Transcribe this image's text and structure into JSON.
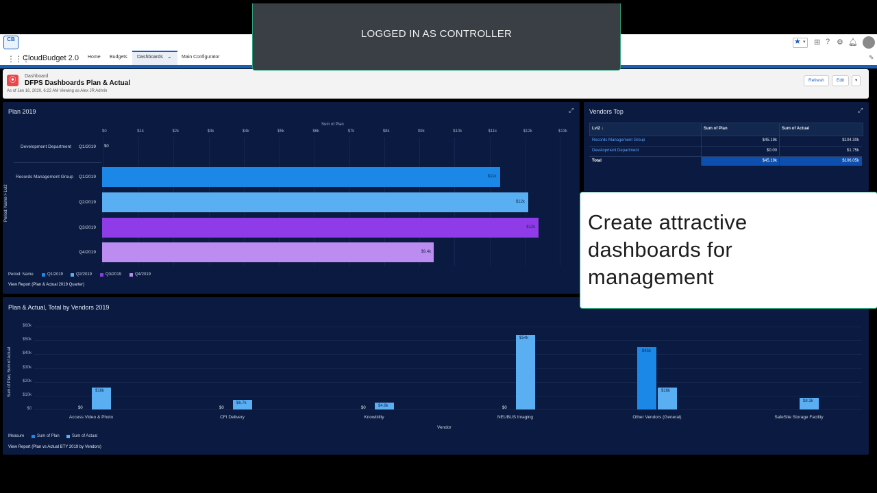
{
  "popup": {
    "text": "LOGGED IN AS CONTROLLER"
  },
  "callout": {
    "text": "Create attractive dashboards for management"
  },
  "header": {
    "logo": "CB",
    "app_name": "CloudBudget 2.0",
    "tabs": [
      "Home",
      "Budgets",
      "Dashboards",
      "Main Configurator"
    ],
    "icons": [
      "star-icon",
      "add-icon",
      "help-icon",
      "gear-icon",
      "bell-icon",
      "avatar"
    ]
  },
  "dashboard": {
    "type_label": "Dashboard",
    "title": "DFPS Dashboards Plan & Actual",
    "subtitle": "As of Jan 16, 2020, 6:22 AM Viewing as Alex JR Admin",
    "buttons": [
      "Refresh",
      "Edit"
    ]
  },
  "plan_panel": {
    "title": "Plan 2019",
    "axis_title": "Sum of Plan",
    "ticks": [
      "$0",
      "$1k",
      "$2k",
      "$3k",
      "$4k",
      "$5k",
      "$6k",
      "$7k",
      "$8k",
      "$9k",
      "$10k",
      "$11k",
      "$12k",
      "$13k"
    ],
    "y_axis_title": "Period: Name > Lvl2",
    "groups": [
      "Development Department",
      "Records Management Group"
    ],
    "legend_title": "Period: Name",
    "view_report": "View Report (Plan & Actual 2019 Quarter)"
  },
  "vendors_panel": {
    "title": "Vendors Top",
    "columns": [
      "Lvl2",
      "Sum of Plan",
      "Sum of Actual"
    ],
    "rows": [
      {
        "name": "Records Management Group",
        "plan": "$45.19k",
        "actual": "$104.30k"
      },
      {
        "name": "Development Department",
        "plan": "$0.00",
        "actual": "$1.75k"
      }
    ],
    "total": {
      "name": "Total",
      "plan": "$45.19k",
      "actual": "$106.05k"
    }
  },
  "vendors_chart_panel": {
    "title": "Plan & Actual, Total by Vendors 2019",
    "y_axis_title": "Sum of Plan, Sum of Actual",
    "x_axis_title": "Vendor",
    "ticks": [
      "$0",
      "$10k",
      "$20k",
      "$30k",
      "$40k",
      "$50k",
      "$60k"
    ],
    "legend_title": "Measure",
    "view_report": "View Report (Plan vs Actual BTY 2019 by Vendors)"
  },
  "colors": {
    "q1": "#1b87e6",
    "q2": "#5aaef2",
    "q3": "#8f3ce8",
    "q4": "#bd8cf0",
    "plan": "#1b87e6",
    "actual": "#5aaef2",
    "panel": "#0a1a40",
    "accent": "#1b5fb4"
  },
  "chart_data": [
    {
      "type": "bar",
      "orientation": "horizontal",
      "title": "Plan 2019",
      "xlabel": "Sum of Plan",
      "ylabel": "Period: Name > Lvl2",
      "xlim": [
        0,
        13000
      ],
      "categories": [
        "Q1/2019",
        "Q1/2019",
        "Q2/2019",
        "Q3/2019",
        "Q4/2019"
      ],
      "groups": [
        "Development Department",
        "Records Management Group",
        "Records Management Group",
        "Records Management Group",
        "Records Management Group"
      ],
      "values": [
        0,
        11300,
        12100,
        12400,
        9400
      ],
      "value_labels": [
        "$0",
        "$11k",
        "$12k",
        "$12k",
        "$9.4k"
      ],
      "colors": [
        "#1b87e6",
        "#1b87e6",
        "#5aaef2",
        "#8f3ce8",
        "#bd8cf0"
      ],
      "legend": [
        "Q1/2019",
        "Q2/2019",
        "Q3/2019",
        "Q4/2019"
      ],
      "legend_position": "bottom-left"
    },
    {
      "type": "bar",
      "title": "Plan & Actual, Total by Vendors 2019",
      "xlabel": "Vendor",
      "ylabel": "Sum of Plan, Sum of Actual",
      "ylim": [
        0,
        60000
      ],
      "categories": [
        "Access Video & Photo",
        "CFI Delivery",
        "Knowbility",
        "NEUBUS Imaging",
        "Other Vendors (General)",
        "SafeSite Storage Facility"
      ],
      "series": [
        {
          "name": "Sum of Plan",
          "values": [
            0,
            0,
            0,
            0,
            45000,
            0
          ],
          "labels": [
            "$0",
            "$0",
            "$0",
            "$0",
            "$45k",
            ""
          ]
        },
        {
          "name": "Sum of Actual",
          "values": [
            16000,
            6700,
            4800,
            54000,
            16000,
            8300
          ],
          "labels": [
            "$16k",
            "$6.7k",
            "$4.8k",
            "$54k",
            "$16k",
            "$8.3k"
          ]
        }
      ],
      "legend_position": "bottom-left"
    }
  ]
}
